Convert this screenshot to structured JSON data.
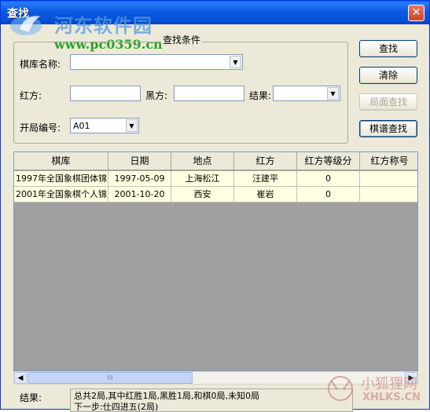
{
  "window": {
    "title": "查找"
  },
  "watermark": {
    "brand": "河东软件园",
    "url": "www.pc0359.cn"
  },
  "search": {
    "group_title": "查找条件",
    "library_label": "棋库名称:",
    "library_value": "",
    "red_label": "红方:",
    "red_value": "",
    "black_label": "黑方:",
    "black_value": "",
    "result_label": "结果:",
    "result_value": "",
    "opening_label": "开局编号:",
    "opening_value": "A01"
  },
  "buttons": {
    "find": "查找",
    "clear": "清除",
    "position_find": "局面查找",
    "manual_find": "棋谱查找"
  },
  "table": {
    "columns": [
      "棋库",
      "日期",
      "地点",
      "红方",
      "红方等级分",
      "红方称号"
    ],
    "rows": [
      [
        "1997年全国象棋团体锦",
        "1997-05-09",
        "上海松江",
        "汪建平",
        "0",
        ""
      ],
      [
        "2001年全国象棋个人锦",
        "2001-10-20",
        "西安",
        "崔岩",
        "0",
        ""
      ]
    ]
  },
  "scrollbar": {
    "thumb_glyph": "III"
  },
  "summary": {
    "label": "结果:",
    "line1": "总共2局,其中红胜1局,黑胜1局,和棋0局,未知0局",
    "line2": "下一步:仕四进五(2局)"
  },
  "watermark2": {
    "brand": "小狐狸网",
    "url": "XHLKS.CN"
  },
  "colors": {
    "titlebar": "#0450d8",
    "row_bg": "#ffffe1",
    "grid_empty": "#a0a0a0",
    "dialog_bg": "#ece9d8"
  }
}
